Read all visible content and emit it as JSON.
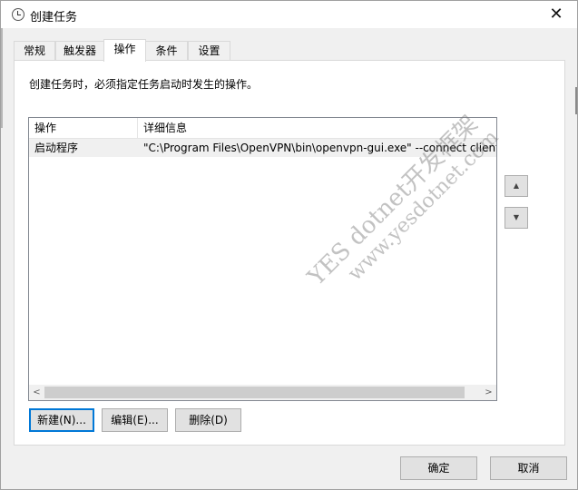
{
  "window": {
    "title": "创建任务",
    "close_glyph": "✕"
  },
  "tabs": [
    {
      "label": "常规"
    },
    {
      "label": "触发器"
    },
    {
      "label": "操作"
    },
    {
      "label": "条件"
    },
    {
      "label": "设置"
    }
  ],
  "active_tab": "操作",
  "actions_panel": {
    "description": "创建任务时，必须指定任务启动时发生的操作。",
    "columns": [
      "操作",
      "详细信息"
    ],
    "rows": [
      {
        "action": "启动程序",
        "details": "\"C:\\Program Files\\OpenVPN\\bin\\openvpn-gui.exe\" --connect client-"
      }
    ],
    "move_up_glyph": "▲",
    "move_down_glyph": "▼",
    "scroll_left_glyph": "<",
    "scroll_right_glyph": ">",
    "new_button": "新建(N)...",
    "edit_button": "编辑(E)...",
    "delete_button": "删除(D)"
  },
  "footer": {
    "ok_button": "确定",
    "cancel_button": "取消"
  },
  "watermark": {
    "line1": "YES dotnet开发框架",
    "line2": "www.yesdotnet.com"
  },
  "colors": {
    "accent": "#0078d7",
    "dialog_bg": "#f0f0f0",
    "panel_bg": "#ffffff"
  }
}
